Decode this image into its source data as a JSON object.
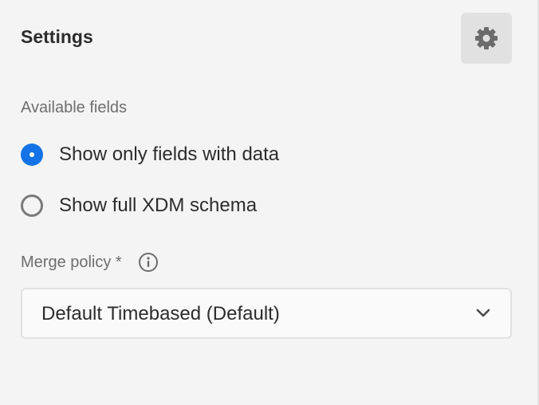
{
  "panel": {
    "title": "Settings"
  },
  "available_fields": {
    "label": "Available fields",
    "options": [
      {
        "label": "Show only fields with data",
        "selected": true
      },
      {
        "label": "Show full XDM schema",
        "selected": false
      }
    ]
  },
  "merge_policy": {
    "label": "Merge policy *",
    "selected_value": "Default Timebased (Default)"
  },
  "icons": {
    "settings": "gear-icon",
    "info": "info-icon",
    "dropdown": "chevron-down-icon"
  },
  "colors": {
    "accent": "#1473e6",
    "background": "#f4f4f4"
  }
}
